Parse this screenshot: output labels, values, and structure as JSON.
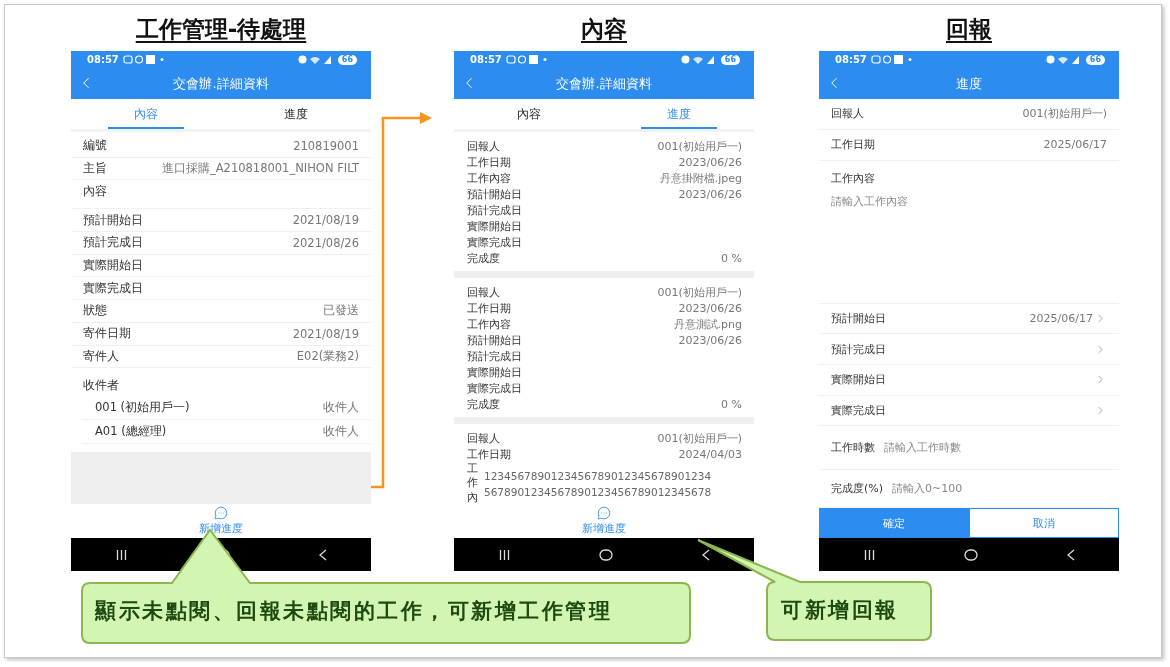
{
  "screens": [
    {
      "kind": "detail",
      "heading": "工作管理-待處理",
      "status_time": "08:57",
      "battery": "66",
      "title": "交會辦.詳細資料",
      "tabs": [
        {
          "label": "內容",
          "selected": true
        },
        {
          "label": "進度",
          "selected": false
        }
      ],
      "fields": [
        {
          "label": "編號",
          "value": "210819001"
        },
        {
          "label": "主旨",
          "value": "進口採購_A210818001_NIHON FILT"
        },
        {
          "label": "內容",
          "tall": true
        },
        {
          "label": "預計開始日",
          "value": "2021/08/19"
        },
        {
          "label": "預計完成日",
          "value": "2021/08/26"
        },
        {
          "label": "實際開始日"
        },
        {
          "label": "實際完成日"
        },
        {
          "label": "狀態",
          "value": "已發送"
        },
        {
          "label": "寄件日期",
          "value": "2021/08/19"
        },
        {
          "label": "寄件人",
          "value": "E02(業務2)"
        }
      ],
      "recipients_label": "收件者",
      "recipients": [
        {
          "name": "001 (初始用戶一)",
          "role": "收件人"
        },
        {
          "name": "A01 (總經理)",
          "role": "收件人"
        }
      ],
      "action": "新增進度"
    },
    {
      "kind": "progress",
      "heading": "內容",
      "status_time": "08:57",
      "battery": "66",
      "title": "交會辦.詳細資料",
      "tabs": [
        {
          "label": "內容",
          "selected": false
        },
        {
          "label": "進度",
          "selected": true
        }
      ],
      "cards": [
        {
          "rows": [
            {
              "label": "回報人",
              "value": "001(初始用戶一)"
            },
            {
              "label": "工作日期",
              "value": "2023/06/26"
            },
            {
              "label": "工作內容",
              "value": "丹意掛附檔.jpeg"
            },
            {
              "label": "預計開始日",
              "value": "2023/06/26"
            },
            {
              "label": "預計完成日"
            },
            {
              "label": "實際開始日"
            },
            {
              "label": "實際完成日"
            },
            {
              "label": "完成度",
              "value": "0 %"
            }
          ]
        },
        {
          "rows": [
            {
              "label": "回報人",
              "value": "001(初始用戶一)"
            },
            {
              "label": "工作日期",
              "value": "2023/06/26"
            },
            {
              "label": "工作內容",
              "value": "丹意測試.png"
            },
            {
              "label": "預計開始日",
              "value": "2023/06/26"
            },
            {
              "label": "預計完成日"
            },
            {
              "label": "實際開始日"
            },
            {
              "label": "實際完成日"
            },
            {
              "label": "完成度",
              "value": "0 %"
            }
          ]
        },
        {
          "rows": [
            {
              "label": "回報人",
              "value": "001(初始用戶一)"
            },
            {
              "label": "工作日期",
              "value": "2024/04/03"
            }
          ],
          "long_row": {
            "label": "工作內",
            "lines": [
              "1234567890123456789012345678901234",
              "5678901234567890123456789012345678"
            ]
          }
        }
      ],
      "action": "新增進度"
    },
    {
      "kind": "form",
      "heading": "回報",
      "status_time": "08:57",
      "battery": "66",
      "title": "進度",
      "items": [
        {
          "kind": "row",
          "label": "回報人",
          "value": "001(初始用戶一)"
        },
        {
          "kind": "row",
          "label": "工作日期",
          "value": "2025/06/17"
        },
        {
          "kind": "textarea",
          "label": "工作內容",
          "placeholder": "請輸入工作內容"
        },
        {
          "kind": "picker",
          "label": "預計開始日",
          "value": "2025/06/17"
        },
        {
          "kind": "picker",
          "label": "預計完成日"
        },
        {
          "kind": "picker",
          "label": "實際開始日"
        },
        {
          "kind": "picker",
          "label": "實際完成日"
        },
        {
          "kind": "input",
          "label": "工作時數",
          "placeholder": "請輸入工作時數"
        },
        {
          "kind": "input",
          "label": "完成度(%)",
          "placeholder": "請輸入0~100"
        }
      ],
      "buttons": [
        {
          "label": "確定",
          "kind": "primary"
        },
        {
          "label": "取消",
          "kind": "secondary"
        }
      ]
    }
  ],
  "callouts": [
    "顯示未點閱、回報未點閱的工作，可新增工作管理",
    "可新增回報"
  ]
}
